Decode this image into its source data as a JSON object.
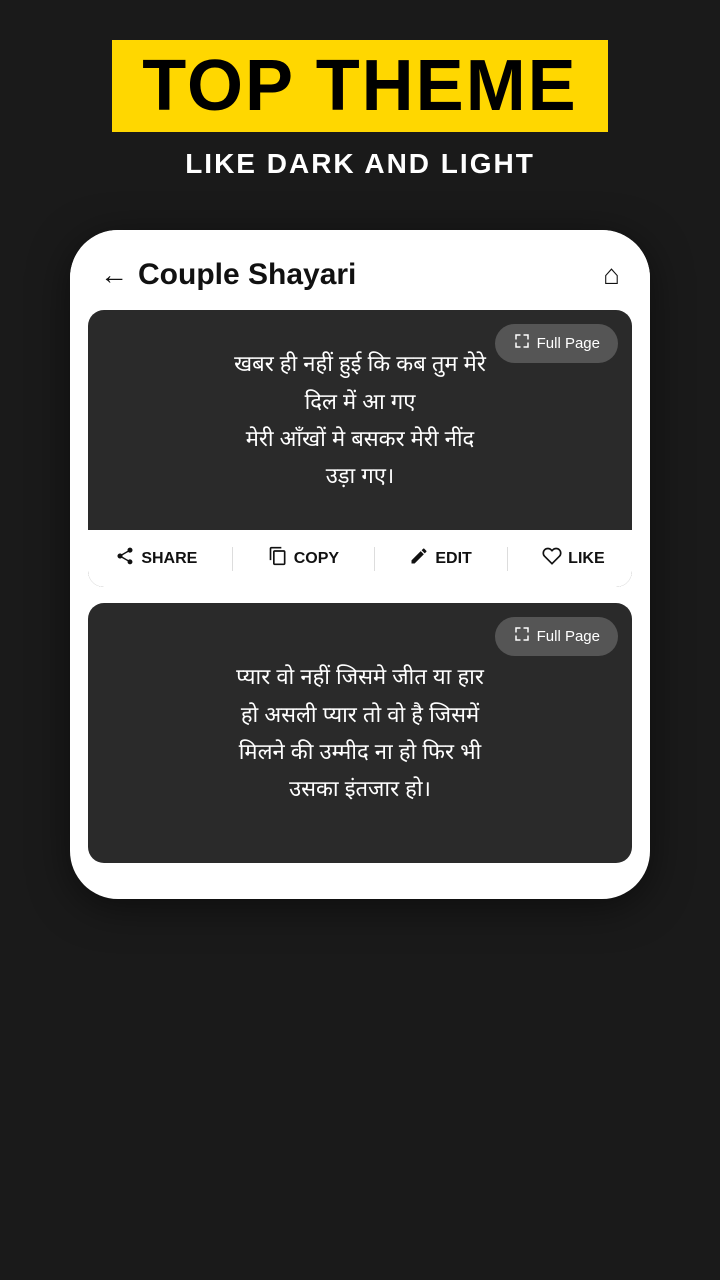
{
  "banner": {
    "top_label": "TOP THEME",
    "subtitle": "LIKE DARK AND LIGHT"
  },
  "phone": {
    "header": {
      "back_icon": "←",
      "title": "Couple Shayari",
      "home_icon": "⌂"
    },
    "cards": [
      {
        "id": "card-1",
        "full_page_label": "Full Page",
        "full_page_icon": "⛶",
        "shayari": "खबर ही नहीं हुई कि कब तुम मेरे\nदिल में आ गए\nमेरी आँखों मे बसकर मेरी नींद\nउड़ा गए।",
        "actions": [
          {
            "id": "share",
            "icon": "share",
            "label": "SHARE"
          },
          {
            "id": "copy",
            "icon": "copy",
            "label": "COPY"
          },
          {
            "id": "edit",
            "icon": "edit",
            "label": "EDIT"
          },
          {
            "id": "like",
            "icon": "like",
            "label": "LIKE"
          }
        ]
      },
      {
        "id": "card-2",
        "full_page_label": "Full Page",
        "full_page_icon": "⛶",
        "shayari": "प्यार वो नहीं जिसमे जीत या हार\nहो असली प्यार तो वो है जिसमें\nमिलने की उम्मीद ना हो फिर भी\nउसका इंतजार हो।",
        "actions": []
      }
    ]
  },
  "colors": {
    "banner_bg": "#FFD700",
    "card_bg": "#2a2a2a",
    "text_white": "#ffffff",
    "text_dark": "#111111",
    "action_bar_bg": "#ffffff"
  }
}
